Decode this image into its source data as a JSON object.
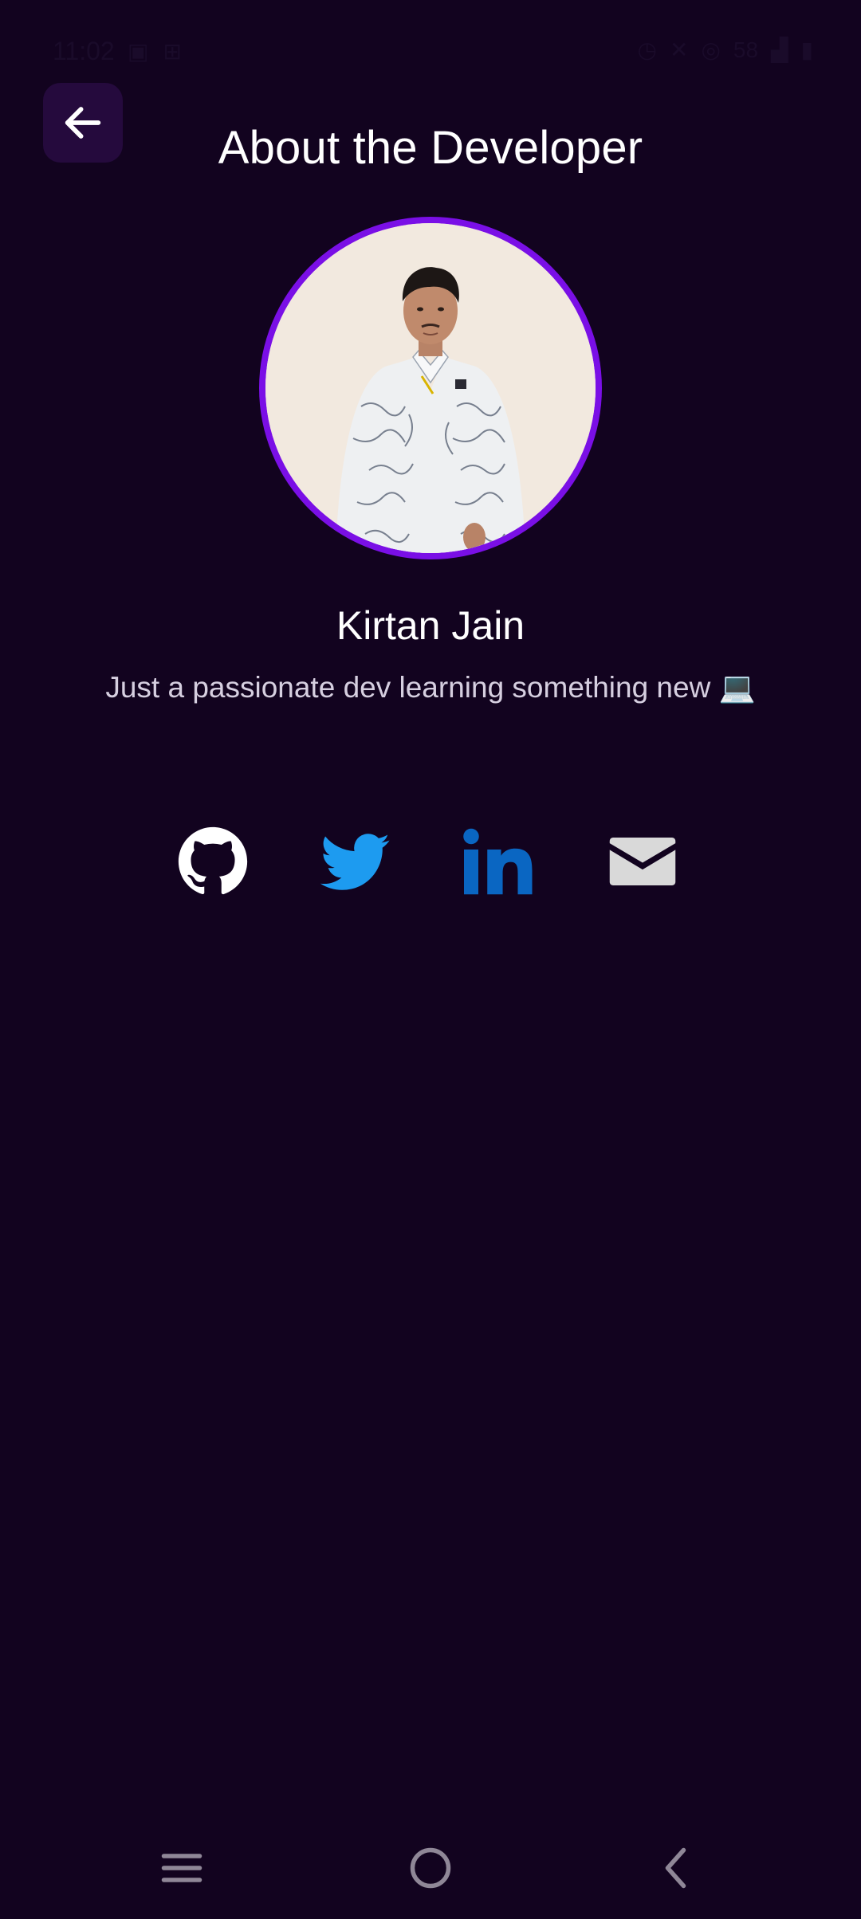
{
  "status_bar": {
    "time": "11:02",
    "battery": "58"
  },
  "header": {
    "title": "About the Developer"
  },
  "profile": {
    "name": "Kirtan Jain",
    "bio": "Just a passionate dev learning something new 💻"
  },
  "social": {
    "github": "github-icon",
    "twitter": "twitter-icon",
    "linkedin": "linkedin-icon",
    "email": "mail-icon"
  },
  "colors": {
    "background": "#12031f",
    "accent_ring": "#7a0fe6",
    "back_button_bg": "#250a3d",
    "twitter_blue": "#1d9bf0",
    "linkedin_blue": "#0a66c2",
    "mail_gray": "#d9d9d9"
  }
}
